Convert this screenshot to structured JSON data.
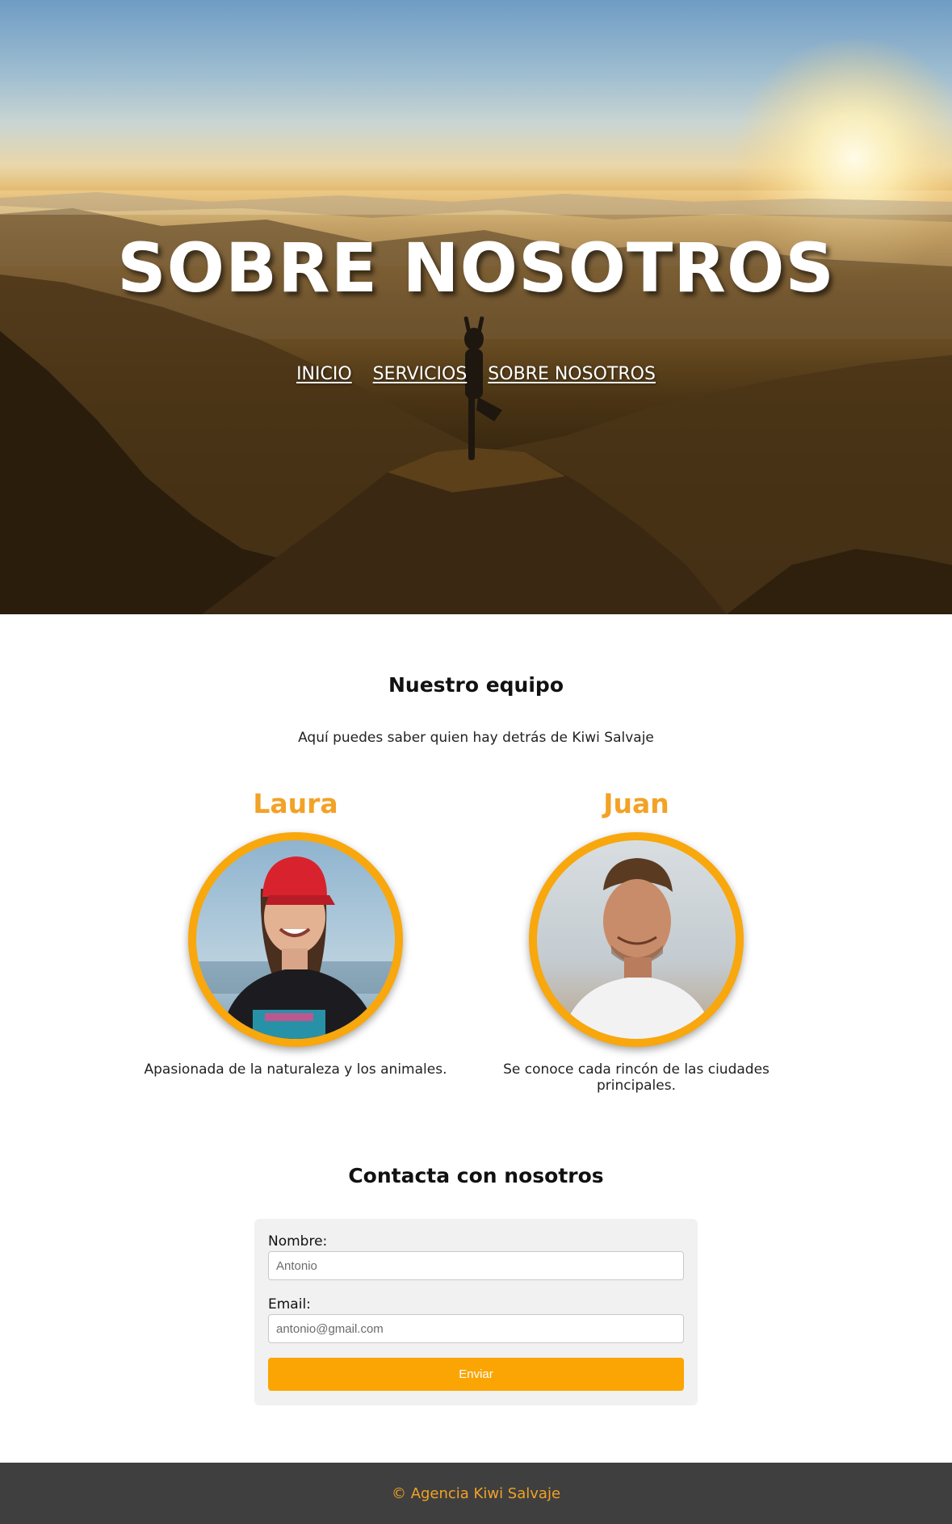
{
  "hero": {
    "title": "SOBRE NOSOTROS",
    "nav": [
      "INICIO",
      "SERVICIOS",
      "SOBRE NOSOTROS"
    ]
  },
  "team": {
    "title": "Nuestro equipo",
    "subtitle": "Aquí puedes saber quien hay detrás de Kiwi Salvaje",
    "members": [
      {
        "name": "Laura",
        "description": "Apasionada de la naturaleza y los animales."
      },
      {
        "name": "Juan",
        "description": "Se conoce cada rincón de las ciudades principales."
      }
    ]
  },
  "contact": {
    "title": "Contacta con nosotros",
    "name_label": "Nombre:",
    "name_placeholder": "Antonio",
    "email_label": "Email:",
    "email_placeholder": "antonio@gmail.com",
    "submit_label": "Enviar"
  },
  "footer": {
    "text": "© Agencia Kiwi Salvaje"
  },
  "colors": {
    "accent": "#f2a226",
    "button": "#faa503",
    "footer_bg": "#3f3f3f"
  }
}
